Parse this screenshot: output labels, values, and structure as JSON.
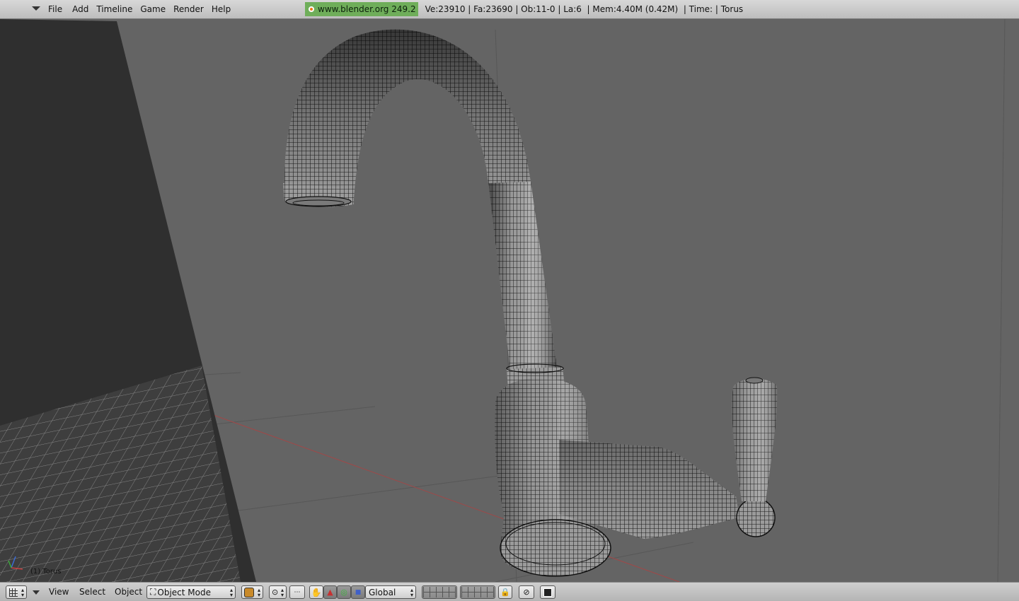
{
  "menu": {
    "items": [
      "File",
      "Add",
      "Timeline",
      "Game",
      "Render",
      "Help"
    ]
  },
  "info": {
    "brand": "www.blender.org 249.2",
    "stats": "Ve:23910 | Fa:23690 | Ob:11-0 | La:6  | Mem:4.40M (0.42M)  | Time: | Torus"
  },
  "viewport": {
    "object_label": "(1) Torus"
  },
  "header": {
    "view": "View",
    "select": "Select",
    "object": "Object",
    "mode": "Object Mode",
    "orientation": "Global"
  }
}
